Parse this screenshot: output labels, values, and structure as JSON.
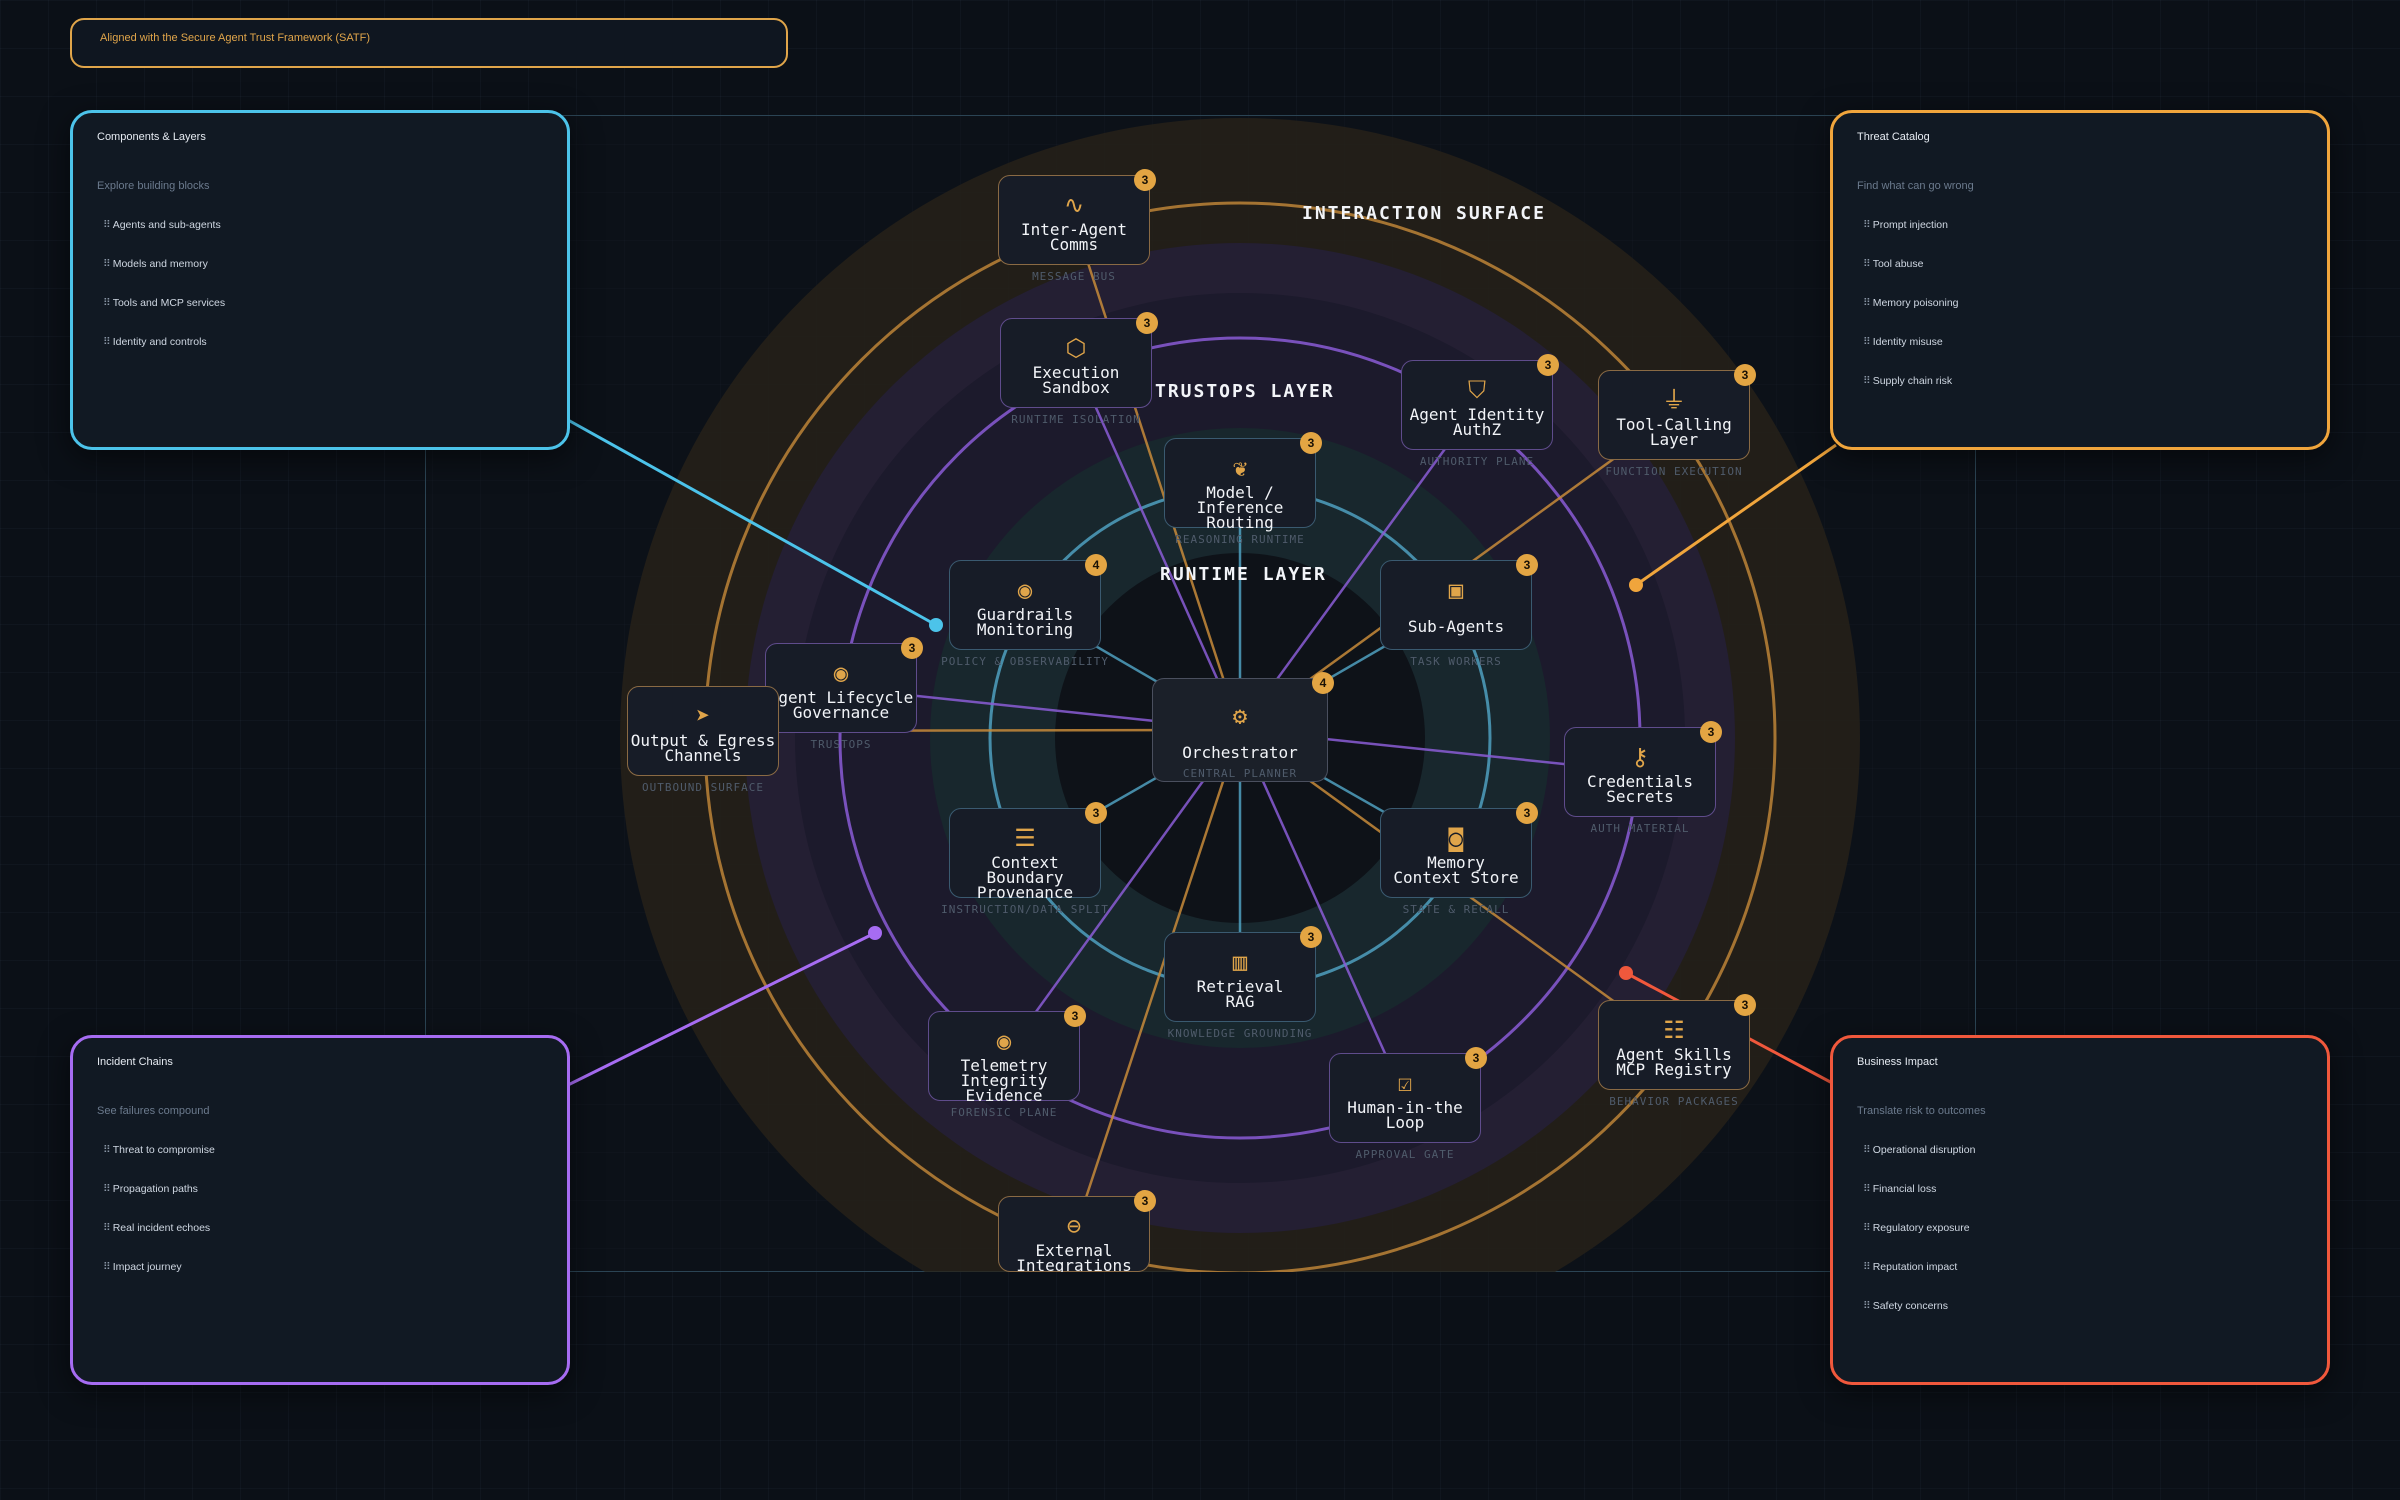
{
  "banner": "Aligned with the Secure Agent Trust Framework (SATF)",
  "panels": {
    "components": {
      "title": "Components & Layers",
      "subtitle": "Explore building blocks",
      "items": [
        "Agents and sub-agents",
        "Models and memory",
        "Tools and MCP services",
        "Identity and controls"
      ],
      "color": "#4cc3ea"
    },
    "threats": {
      "title": "Threat Catalog",
      "subtitle": "Find what can go wrong",
      "items": [
        "Prompt injection",
        "Tool abuse",
        "Memory poisoning",
        "Identity misuse",
        "Supply chain risk"
      ],
      "color": "#f0a53c"
    },
    "incidents": {
      "title": "Incident Chains",
      "subtitle": "See failures compound",
      "items": [
        "Threat to compromise",
        "Propagation paths",
        "Real incident echoes",
        "Impact journey"
      ],
      "color": "#a66cf2"
    },
    "impact": {
      "title": "Business Impact",
      "subtitle": "Translate risk to outcomes",
      "items": [
        "Operational disruption",
        "Financial loss",
        "Regulatory exposure",
        "Reputation impact",
        "Safety concerns"
      ],
      "color": "#f0583c"
    }
  },
  "layers": {
    "interaction": "INTERACTION SURFACE",
    "trustops": "TRUSTOPS LAYER",
    "runtime": "RUNTIME LAYER"
  },
  "colors": {
    "runtime": "#4fa0bf",
    "trustops": "#8a5cd6",
    "interaction": "#c78a3a",
    "badge": "#e3a543",
    "icon": "#e0a54a"
  },
  "nodes": {
    "orchestrator": {
      "label": "Orchestrator",
      "caption": "CENTRAL PLANNER",
      "badge": "4",
      "icon": "gear-icon"
    },
    "model_routing": {
      "label": "Model / Inference\nRouting",
      "caption": "REASONING RUNTIME",
      "badge": "3",
      "icon": "brain-icon"
    },
    "guardrails": {
      "label": "Guardrails\nMonitoring",
      "caption": "POLICY & OBSERVABILITY",
      "badge": "4",
      "icon": "eye-icon"
    },
    "sub_agents": {
      "label": "Sub-Agents",
      "caption": "TASK WORKERS",
      "badge": "3",
      "icon": "robot-icon"
    },
    "context_boundary": {
      "label": "Context Boundary\nProvenance",
      "caption": "INSTRUCTION/DATA SPLIT",
      "badge": "3",
      "icon": "layers-icon"
    },
    "memory": {
      "label": "Memory\nContext Store",
      "caption": "STATE & RECALL",
      "badge": "3",
      "icon": "database-icon"
    },
    "retrieval": {
      "label": "Retrieval\nRAG",
      "caption": "KNOWLEDGE GROUNDING",
      "badge": "3",
      "icon": "book-icon"
    },
    "execution_sandbox": {
      "label": "Execution\nSandbox",
      "caption": "RUNTIME ISOLATION",
      "badge": "3",
      "icon": "cube-icon"
    },
    "agent_identity": {
      "label": "Agent Identity\nAuthZ",
      "caption": "AUTHORITY PLANE",
      "badge": "3",
      "icon": "shield-check-icon"
    },
    "lifecycle": {
      "label": "Agent Lifecycle\nGovernance",
      "caption": "TRUSTOPS",
      "badge": "3",
      "icon": "eye-icon"
    },
    "credentials": {
      "label": "Credentials\nSecrets",
      "caption": "AUTH MATERIAL",
      "badge": "3",
      "icon": "key-icon"
    },
    "telemetry": {
      "label": "Telemetry Integrity\nEvidence",
      "caption": "FORENSIC PLANE",
      "badge": "3",
      "icon": "eye-icon"
    },
    "human_loop": {
      "label": "Human-in-the\nLoop",
      "caption": "APPROVAL GATE",
      "badge": "3",
      "icon": "checkbox-icon"
    },
    "inter_agent": {
      "label": "Inter-Agent\nComms",
      "caption": "MESSAGE BUS",
      "badge": "3",
      "icon": "wave-icon"
    },
    "tool_calling": {
      "label": "Tool-Calling\nLayer",
      "caption": "FUNCTION EXECUTION",
      "badge": "3",
      "icon": "plug-icon"
    },
    "output_egress": {
      "label": "Output & Egress\nChannels",
      "caption": "OUTBOUND SURFACE",
      "badge": "",
      "icon": "send-icon"
    },
    "skills_registry": {
      "label": "Agent Skills\nMCP Registry",
      "caption": "BEHAVIOR PACKAGES",
      "badge": "3",
      "icon": "server-icon"
    },
    "external": {
      "label": "External\nIntegrations",
      "caption": "",
      "badge": "3",
      "icon": "globe-icon"
    }
  }
}
